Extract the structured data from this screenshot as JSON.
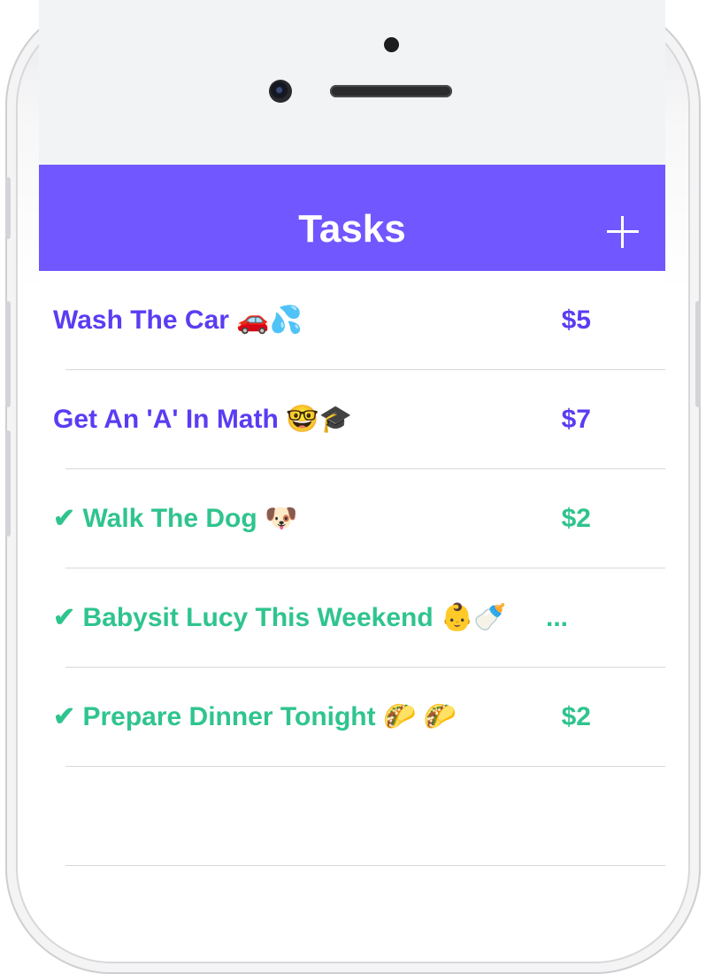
{
  "nav": {
    "title": "Tasks",
    "add_icon": "plus-icon"
  },
  "colors": {
    "nav_bg": "#7157ff",
    "pending": "#5b3cf2",
    "done": "#2fc48e"
  },
  "tasks": [
    {
      "label": "Wash The Car 🚗💦",
      "price": "$5",
      "status": "pending"
    },
    {
      "label": "Get An 'A' In Math 🤓🎓",
      "price": "$7",
      "status": "pending"
    },
    {
      "label": "✔ Walk The Dog 🐶",
      "price": "$2",
      "status": "done"
    },
    {
      "label": "✔ Babysit Lucy This Weekend 👶🍼",
      "price": "...",
      "status": "done"
    },
    {
      "label": "✔ Prepare Dinner Tonight 🌮 🌮",
      "price": "$2",
      "status": "done"
    }
  ]
}
